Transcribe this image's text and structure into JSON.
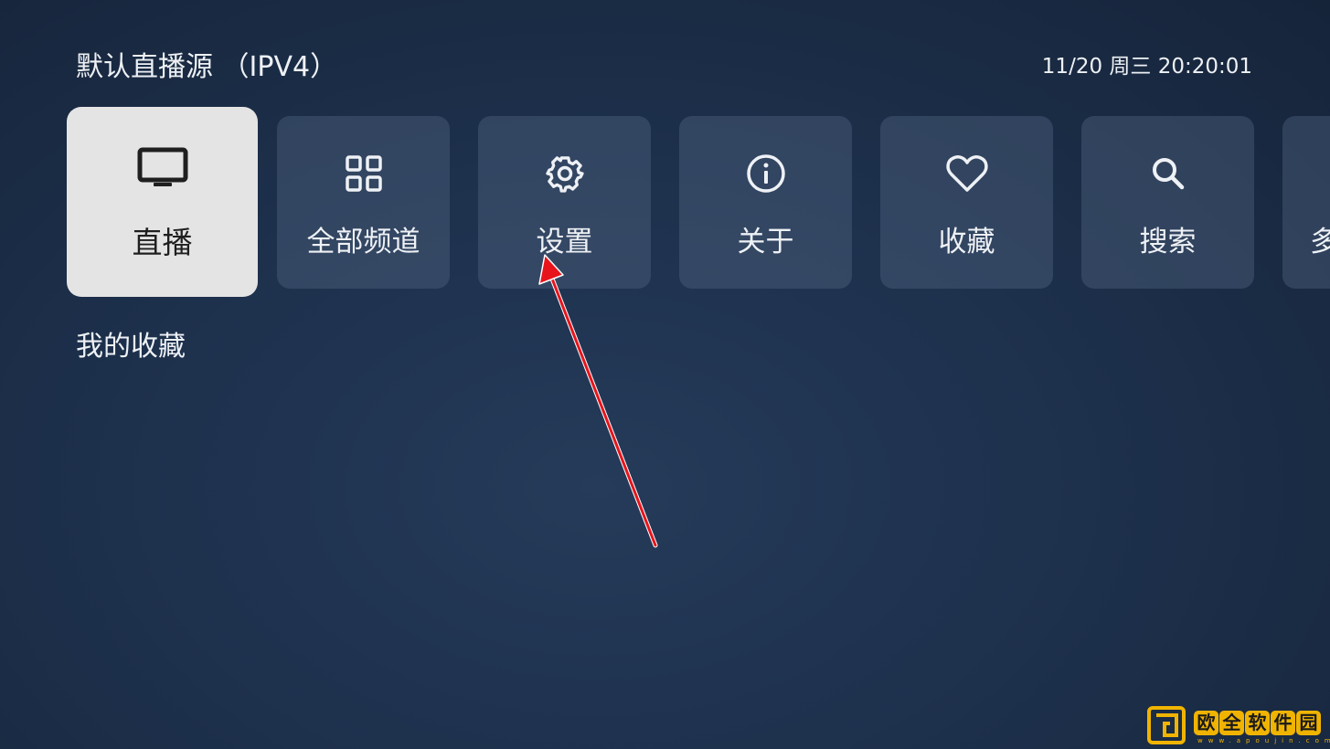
{
  "header": {
    "source_title": "默认直播源 （IPV4）",
    "clock": "11/20 周三 20:20:01"
  },
  "menu": {
    "selected_index": 0,
    "items": [
      {
        "label": "直播",
        "icon": "tv-icon"
      },
      {
        "label": "全部频道",
        "icon": "grid-icon"
      },
      {
        "label": "设置",
        "icon": "gear-icon"
      },
      {
        "label": "关于",
        "icon": "info-icon"
      },
      {
        "label": "收藏",
        "icon": "heart-icon"
      },
      {
        "label": "搜索",
        "icon": "search-icon"
      },
      {
        "label": "多",
        "icon": ""
      }
    ]
  },
  "favorites": {
    "title": "我的收藏"
  },
  "annotation": {
    "arrow_color": "#e8141c"
  },
  "watermark": {
    "chars": [
      "欧",
      "全",
      "软",
      "件",
      "园"
    ],
    "url": "www.apoujin.com"
  },
  "colors": {
    "background": "#1f3350",
    "card": "#3b4d66",
    "card_selected": "#e4e4e4",
    "accent_watermark": "#f0b400"
  }
}
